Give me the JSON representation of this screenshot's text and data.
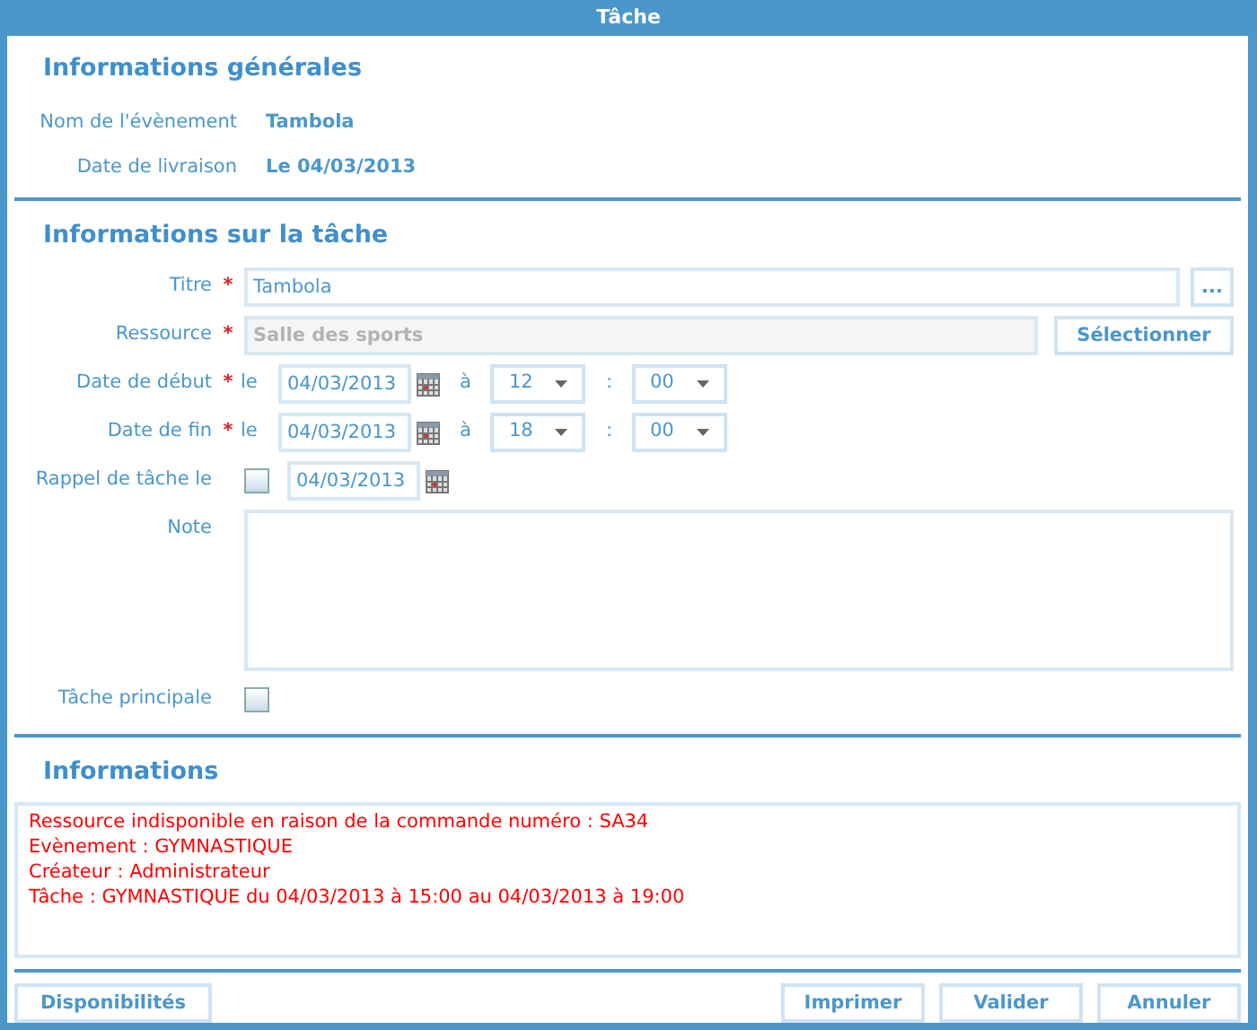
{
  "window": {
    "title": "Tâche"
  },
  "general": {
    "heading": "Informations générales",
    "fields": [
      {
        "label": "Nom de l'évènement",
        "value": "Tambola"
      },
      {
        "label": "Date de livraison",
        "value": "Le 04/03/2013"
      }
    ]
  },
  "task": {
    "heading": "Informations sur la tâche",
    "title": {
      "label": "Titre",
      "required_mark": "*",
      "value": "Tambola",
      "button": "..."
    },
    "resource": {
      "label": "Ressource",
      "required_mark": "*",
      "value": "Salle des sports",
      "disabled": true,
      "button": "Sélectionner"
    },
    "dates": [
      {
        "label": "Date de début",
        "required_mark": "*",
        "prefix": "le",
        "date": "04/03/2013",
        "at": "à",
        "hour": "12",
        "separator": ":",
        "minute": "00"
      },
      {
        "label": "Date de fin",
        "required_mark": "*",
        "prefix": "le",
        "date": "04/03/2013",
        "at": "à",
        "hour": "18",
        "separator": ":",
        "minute": "00"
      }
    ],
    "reminder": {
      "label": "Rappel de tâche le",
      "checked": false,
      "date": "04/03/2013"
    },
    "note": {
      "label": "Note"
    },
    "main_task": {
      "label": "Tâche principale",
      "checked": false
    }
  },
  "informations": {
    "heading": "Informations",
    "lines": [
      "Ressource indisponible en raison de la commande numéro : SA34",
      "Evènement : GYMNASTIQUE",
      "Créateur : Administrateur",
      "Tâche : GYMNASTIQUE du 04/03/2013 à 15:00 au 04/03/2013 à 19:00"
    ]
  },
  "footer": {
    "left_buttons": [
      "Disponibilités"
    ],
    "right_buttons": [
      "Imprimer",
      "Valider",
      "Annuler"
    ]
  }
}
